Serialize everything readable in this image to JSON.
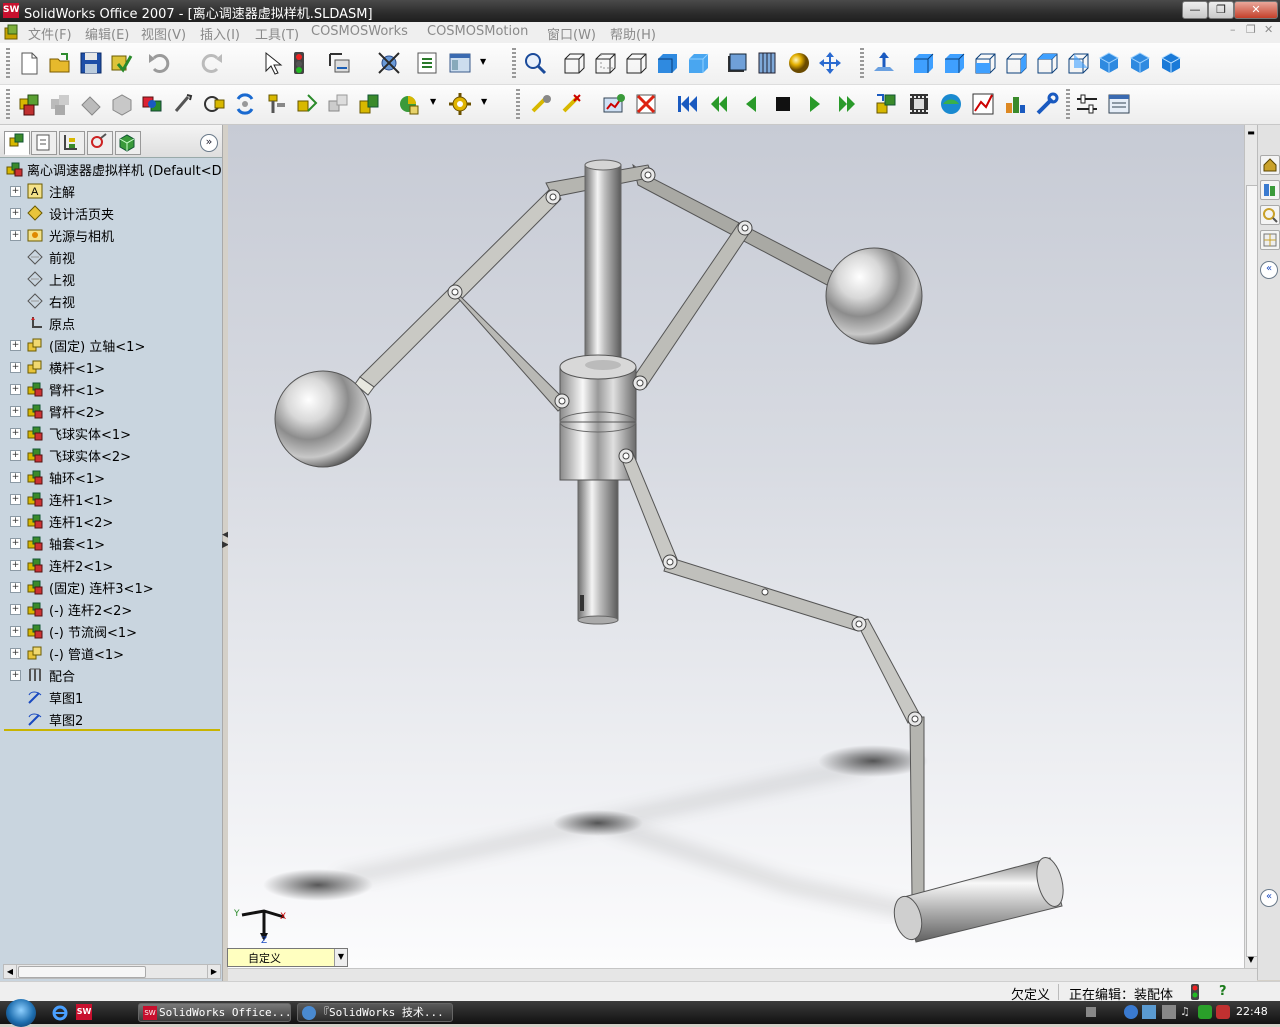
{
  "window": {
    "title": "SolidWorks Office 2007 - [离心调速器虚拟样机.SLDASM]",
    "app_icon": "SW",
    "buttons": [
      "minimize",
      "restore",
      "close"
    ]
  },
  "menubar": {
    "items": [
      "文件(F)",
      "编辑(E)",
      "视图(V)",
      "插入(I)",
      "工具(T)",
      "COSMOSWorks",
      "COSMOSMotion",
      "窗口(W)",
      "帮助(H)"
    ]
  },
  "toolbar1": {
    "icons": [
      "new-icon",
      "open-icon",
      "save-icon",
      "rebuild-icon",
      "undo-icon",
      "redo-icon",
      "select-icon",
      "traffic-light-icon",
      "smart-dimension-icon",
      "options-icon",
      "property-icon",
      "view-window-icon",
      "zoom-fit-icon",
      "view-front-icon",
      "view-back-icon",
      "view-left-icon",
      "shaded-icon",
      "shaded-edges-icon",
      "section-view-icon",
      "hidden-lines-icon",
      "realview-icon",
      "move-icon",
      "normal-to-icon",
      "iso-view-1-icon",
      "iso-view-2-icon",
      "iso-view-3-icon",
      "iso-view-4-icon",
      "iso-view-5-icon",
      "iso-view-6-icon",
      "iso-view-7-icon",
      "iso-view-8-icon"
    ]
  },
  "toolbar2": {
    "icons": [
      "insert-component-icon",
      "hide-component-icon",
      "mate-icon",
      "smart-mates-icon",
      "move-component-icon",
      "rotate-component-icon",
      "suppress-icon",
      "explode-icon",
      "explode-line-icon",
      "interference-icon",
      "collision-icon",
      "assembly-feature-icon",
      "simulation-icon",
      "motion-part-icon",
      "motion-joint-icon",
      "motion-force-icon",
      "delete-simulation-icon",
      "rewind-icon",
      "step-back-icon",
      "play-back-icon",
      "stop-icon",
      "play-icon",
      "step-forward-icon",
      "motion-contact-icon",
      "animation-icon",
      "trace-icon",
      "plot-icon",
      "results-icon",
      "motion-options-icon",
      "motion-settings-icon",
      "motion-export-icon"
    ]
  },
  "featuretree": {
    "tabs": [
      "feature-manager-tab",
      "property-manager-tab",
      "configuration-manager-tab",
      "dimxpert-tab",
      "display-manager-tab"
    ],
    "root": "离心调速器虚拟样机 (Default<D",
    "items": [
      {
        "label": "注解",
        "expand": "+",
        "icon": "annotations-icon"
      },
      {
        "label": "设计活页夹",
        "expand": "+",
        "icon": "design-binder-icon"
      },
      {
        "label": "光源与相机",
        "expand": "+",
        "icon": "lights-cameras-icon"
      },
      {
        "label": "前视",
        "expand": "",
        "icon": "plane-icon"
      },
      {
        "label": "上视",
        "expand": "",
        "icon": "plane-icon"
      },
      {
        "label": "右视",
        "expand": "",
        "icon": "plane-icon"
      },
      {
        "label": "原点",
        "expand": "",
        "icon": "origin-icon"
      },
      {
        "label": "(固定) 立轴<1>",
        "expand": "+",
        "icon": "part-icon"
      },
      {
        "label": "横杆<1>",
        "expand": "+",
        "icon": "part-icon"
      },
      {
        "label": "臂杆<1>",
        "expand": "+",
        "icon": "subassembly-icon"
      },
      {
        "label": "臂杆<2>",
        "expand": "+",
        "icon": "subassembly-icon"
      },
      {
        "label": "飞球实体<1>",
        "expand": "+",
        "icon": "subassembly-icon"
      },
      {
        "label": "飞球实体<2>",
        "expand": "+",
        "icon": "subassembly-icon"
      },
      {
        "label": "轴环<1>",
        "expand": "+",
        "icon": "subassembly-icon"
      },
      {
        "label": "连杆1<1>",
        "expand": "+",
        "icon": "subassembly-icon"
      },
      {
        "label": "连杆1<2>",
        "expand": "+",
        "icon": "subassembly-icon"
      },
      {
        "label": "轴套<1>",
        "expand": "+",
        "icon": "subassembly-icon"
      },
      {
        "label": "连杆2<1>",
        "expand": "+",
        "icon": "subassembly-icon"
      },
      {
        "label": "(固定) 连杆3<1>",
        "expand": "+",
        "icon": "subassembly-icon"
      },
      {
        "label": "(-) 连杆2<2>",
        "expand": "+",
        "icon": "subassembly-icon"
      },
      {
        "label": "(-) 节流阀<1>",
        "expand": "+",
        "icon": "subassembly-icon"
      },
      {
        "label": "(-) 管道<1>",
        "expand": "+",
        "icon": "part-icon"
      },
      {
        "label": "配合",
        "expand": "+",
        "icon": "mates-icon"
      },
      {
        "label": "草图1",
        "expand": "",
        "icon": "sketch-icon"
      },
      {
        "label": "草图2",
        "expand": "",
        "icon": "sketch-icon"
      }
    ]
  },
  "viewport": {
    "model": "centrifugal-governor-assembly",
    "triad": {
      "x": "X",
      "y": "Y",
      "z": "Z"
    },
    "view_combo": "自定义"
  },
  "statusbar": {
    "under_defined": "欠定义",
    "editing": "正在编辑：装配体",
    "help": "?"
  },
  "taskbar": {
    "tasks": [
      "SolidWorks Office...",
      "『SolidWorks 技术..."
    ],
    "clock": "22:48"
  }
}
